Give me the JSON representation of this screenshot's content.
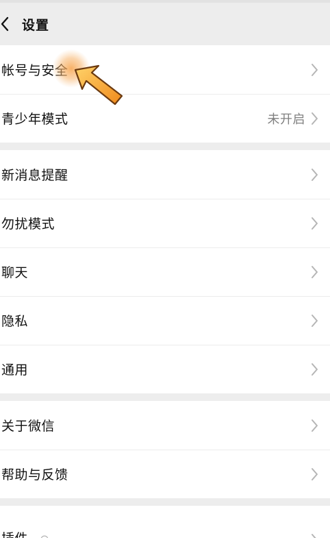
{
  "nav": {
    "title": "设置"
  },
  "groups": [
    {
      "items": [
        {
          "label": "帐号与安全",
          "value": ""
        },
        {
          "label": "青少年模式",
          "value": "未开启"
        }
      ]
    },
    {
      "items": [
        {
          "label": "新消息提醒",
          "value": ""
        },
        {
          "label": "勿扰模式",
          "value": ""
        },
        {
          "label": "聊天",
          "value": ""
        },
        {
          "label": "隐私",
          "value": ""
        },
        {
          "label": "通用",
          "value": ""
        }
      ]
    },
    {
      "items": [
        {
          "label": "关于微信",
          "value": ""
        },
        {
          "label": "帮助与反馈",
          "value": ""
        }
      ]
    },
    {
      "items": [
        {
          "label": "插件",
          "value": ""
        }
      ]
    }
  ],
  "icons": {
    "back": "chevron-left-icon",
    "row_arrow": "chevron-right-icon",
    "plugin_badge": "plugin-badge-icon",
    "pointer": "hand-pointer-arrow-icon"
  },
  "colors": {
    "background": "#ededed",
    "row": "#ffffff",
    "secondary_text": "#7f7f7f",
    "chevron": "#b5b5b5",
    "pointer_orange": "#f39a2b"
  }
}
